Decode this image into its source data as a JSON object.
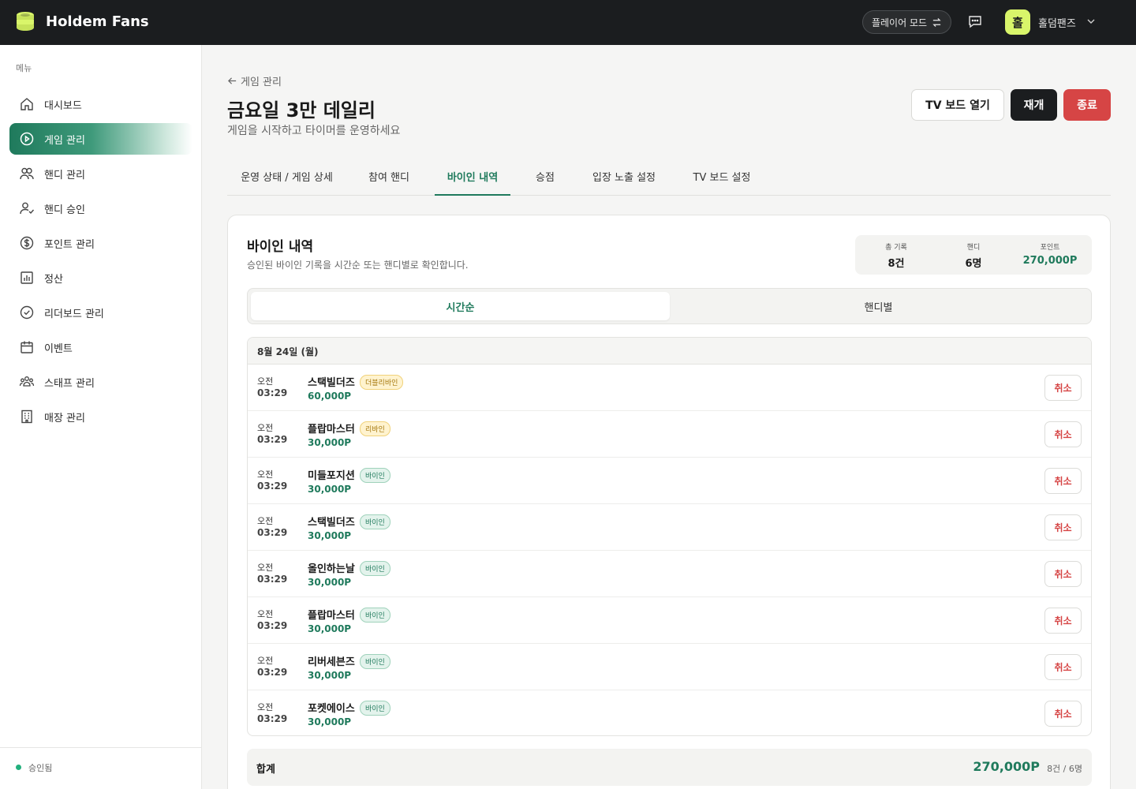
{
  "app": {
    "brand": "Holdem Fans"
  },
  "topbar": {
    "mode_label": "플레이어 모드",
    "avatar_initial": "홀",
    "user_name": "홀덤팬즈"
  },
  "sidebar": {
    "menu_title": "메뉴",
    "items": [
      {
        "label": "대시보드",
        "icon": "home-icon"
      },
      {
        "label": "게임 관리",
        "icon": "play-circle-icon",
        "active": true
      },
      {
        "label": "핸디 관리",
        "icon": "users-icon"
      },
      {
        "label": "핸디 승인",
        "icon": "user-check-icon"
      },
      {
        "label": "포인트 관리",
        "icon": "dollar-circle-icon"
      },
      {
        "label": "정산",
        "icon": "bar-chart-icon"
      },
      {
        "label": "리더보드 관리",
        "icon": "check-circle-icon"
      },
      {
        "label": "이벤트",
        "icon": "calendar-icon"
      },
      {
        "label": "스태프 관리",
        "icon": "team-icon"
      },
      {
        "label": "매장 관리",
        "icon": "building-icon"
      }
    ],
    "footer_status": "승인됨"
  },
  "header": {
    "back_label": "게임 관리",
    "title": "금요일 3만 데일리",
    "subtitle": "게임을 시작하고 타이머를 운영하세요",
    "buttons": {
      "tv": "TV 보드 열기",
      "resume": "재개",
      "end": "종료"
    }
  },
  "tabs": [
    "운영 상태 / 게임 상세",
    "참여 핸디",
    "바이인 내역",
    "승점",
    "입장 노출 설정",
    "TV 보드 설정"
  ],
  "active_tab": "바이인 내역",
  "card": {
    "title": "바이인 내역",
    "subtitle": "승인된 바이인 기록을 시간순 또는 핸디별로 확인합니다.",
    "stats": [
      {
        "label": "총 기록",
        "value": "8건"
      },
      {
        "label": "핸디",
        "value": "6명"
      },
      {
        "label": "포인트",
        "value": "270,000P"
      }
    ],
    "segments": [
      "시간순",
      "핸디별"
    ],
    "date_header": "8월 24일 (월)",
    "cancel_label": "취소",
    "rows": [
      {
        "ampm": "오전",
        "time": "03:29",
        "name": "스택빌더즈",
        "badge": "더블리바인",
        "badge_type": "double",
        "amount": "60,000P"
      },
      {
        "ampm": "오전",
        "time": "03:29",
        "name": "플랍마스터",
        "badge": "리바인",
        "badge_type": "rebuy",
        "amount": "30,000P"
      },
      {
        "ampm": "오전",
        "time": "03:29",
        "name": "미들포지션",
        "badge": "바이인",
        "badge_type": "buyin",
        "amount": "30,000P"
      },
      {
        "ampm": "오전",
        "time": "03:29",
        "name": "스택빌더즈",
        "badge": "바이인",
        "badge_type": "buyin",
        "amount": "30,000P"
      },
      {
        "ampm": "오전",
        "time": "03:29",
        "name": "올인하는날",
        "badge": "바이인",
        "badge_type": "buyin",
        "amount": "30,000P"
      },
      {
        "ampm": "오전",
        "time": "03:29",
        "name": "플랍마스터",
        "badge": "바이인",
        "badge_type": "buyin",
        "amount": "30,000P"
      },
      {
        "ampm": "오전",
        "time": "03:29",
        "name": "리버세븐즈",
        "badge": "바이인",
        "badge_type": "buyin",
        "amount": "30,000P"
      },
      {
        "ampm": "오전",
        "time": "03:29",
        "name": "포켓에이스",
        "badge": "바이인",
        "badge_type": "buyin",
        "amount": "30,000P"
      }
    ],
    "total": {
      "label": "합계",
      "value": "270,000P",
      "meta": "8건 / 6명"
    }
  },
  "colors": {
    "accent": "#1f7a5c",
    "danger": "#d64545",
    "topbar": "#1b1d1f",
    "avatar": "#d9f56a"
  }
}
